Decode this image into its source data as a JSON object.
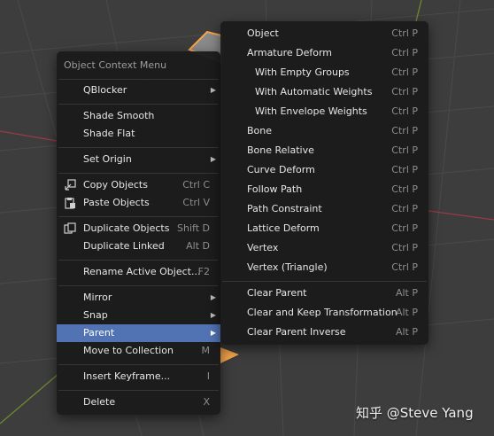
{
  "context_menu": {
    "title": "Object Context Menu",
    "items": [
      {
        "label": "QBlocker",
        "shortcut": "",
        "submenu": true
      },
      {
        "label": "Shade Smooth",
        "shortcut": ""
      },
      {
        "label": "Shade Flat",
        "shortcut": ""
      },
      {
        "label": "Set Origin",
        "shortcut": "",
        "submenu": true
      },
      {
        "label": "Copy Objects",
        "shortcut": "Ctrl C",
        "icon": "copy-icon"
      },
      {
        "label": "Paste Objects",
        "shortcut": "Ctrl V",
        "icon": "paste-icon"
      },
      {
        "label": "Duplicate Objects",
        "shortcut": "Shift D",
        "icon": "duplicate-icon"
      },
      {
        "label": "Duplicate Linked",
        "shortcut": "Alt D"
      },
      {
        "label": "Rename Active Object...",
        "shortcut": "F2"
      },
      {
        "label": "Mirror",
        "shortcut": "",
        "submenu": true
      },
      {
        "label": "Snap",
        "shortcut": "",
        "submenu": true
      },
      {
        "label": "Parent",
        "shortcut": "",
        "submenu": true,
        "active": true
      },
      {
        "label": "Move to Collection",
        "shortcut": "M"
      },
      {
        "label": "Insert Keyframe...",
        "shortcut": "I"
      },
      {
        "label": "Delete",
        "shortcut": "X"
      }
    ]
  },
  "parent_submenu": {
    "items": [
      {
        "label": "Object",
        "shortcut": "Ctrl P"
      },
      {
        "label": "Armature Deform",
        "shortcut": "Ctrl P"
      },
      {
        "label": "With Empty Groups",
        "shortcut": "Ctrl P",
        "indent": true
      },
      {
        "label": "With Automatic Weights",
        "shortcut": "Ctrl P",
        "indent": true
      },
      {
        "label": "With Envelope Weights",
        "shortcut": "Ctrl P",
        "indent": true
      },
      {
        "label": "Bone",
        "shortcut": "Ctrl P"
      },
      {
        "label": "Bone Relative",
        "shortcut": "Ctrl P"
      },
      {
        "label": "Curve Deform",
        "shortcut": "Ctrl P"
      },
      {
        "label": "Follow Path",
        "shortcut": "Ctrl P"
      },
      {
        "label": "Path Constraint",
        "shortcut": "Ctrl P"
      },
      {
        "label": "Lattice Deform",
        "shortcut": "Ctrl P"
      },
      {
        "label": "Vertex",
        "shortcut": "Ctrl P"
      },
      {
        "label": "Vertex (Triangle)",
        "shortcut": "Ctrl P"
      },
      {
        "label": "Clear Parent",
        "shortcut": "Alt P"
      },
      {
        "label": "Clear and Keep Transformation",
        "shortcut": "Alt P"
      },
      {
        "label": "Clear Parent Inverse",
        "shortcut": "Alt P"
      }
    ]
  },
  "watermark": "知乎 @Steve Yang",
  "colors": {
    "highlight": "#5173b3",
    "viewport_bg": "#3d3d3d",
    "object_outline": "#f5a54a"
  }
}
